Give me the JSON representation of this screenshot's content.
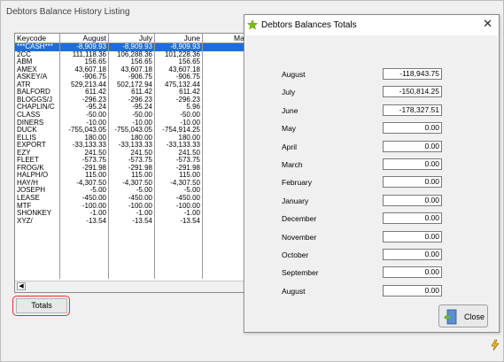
{
  "main_window": {
    "title": "Debtors Balance History Listing",
    "totals_button": "Totals"
  },
  "grid": {
    "columns": [
      "Keycode",
      "August",
      "July",
      "June",
      "Ma"
    ],
    "rows": [
      {
        "keycode": "***CASH***",
        "august": "-8,909.93",
        "july": "-8,909.93",
        "june": "-8,909.93"
      },
      {
        "keycode": "2CC",
        "august": "111,118.36",
        "july": "106,288.36",
        "june": "101,228.36"
      },
      {
        "keycode": "ABM",
        "august": "156.65",
        "july": "156.65",
        "june": "156.65"
      },
      {
        "keycode": "AMEX",
        "august": "43,607.18",
        "july": "43,607.18",
        "june": "43,607.18"
      },
      {
        "keycode": "ASKEY/A",
        "august": "-906.75",
        "july": "-906.75",
        "june": "-906.75"
      },
      {
        "keycode": "ATR",
        "august": "529,213.44",
        "july": "502,172.94",
        "june": "475,132.44"
      },
      {
        "keycode": "BALFORD",
        "august": "611.42",
        "july": "611.42",
        "june": "611.42"
      },
      {
        "keycode": "BLOGGS/J",
        "august": "-296.23",
        "july": "-296.23",
        "june": "-296.23"
      },
      {
        "keycode": "CHAPLIN/C",
        "august": "-95.24",
        "july": "-95.24",
        "june": "5.96"
      },
      {
        "keycode": "CLASS",
        "august": "-50.00",
        "july": "-50.00",
        "june": "-50.00"
      },
      {
        "keycode": "DINERS",
        "august": "-10.00",
        "july": "-10.00",
        "june": "-10.00"
      },
      {
        "keycode": "DUCK",
        "august": "-755,043.05",
        "july": "-755,043.05",
        "june": "-754,914.25"
      },
      {
        "keycode": "ELLIS",
        "august": "180.00",
        "july": "180.00",
        "june": "180.00"
      },
      {
        "keycode": "EXPORT",
        "august": "-33,133.33",
        "july": "-33,133.33",
        "june": "-33,133.33"
      },
      {
        "keycode": "EZY",
        "august": "241.50",
        "july": "241.50",
        "june": "241.50"
      },
      {
        "keycode": "FLEET",
        "august": "-573.75",
        "july": "-573.75",
        "june": "-573.75"
      },
      {
        "keycode": "FROG/K",
        "august": "-291.98",
        "july": "-291.98",
        "june": "-291.98"
      },
      {
        "keycode": "HALPH/O",
        "august": "115.00",
        "july": "115.00",
        "june": "115.00"
      },
      {
        "keycode": "HAY/H",
        "august": "-4,307.50",
        "july": "-4,307.50",
        "june": "-4,307.50"
      },
      {
        "keycode": "JOSEPH",
        "august": "-5.00",
        "july": "-5.00",
        "june": "-5.00"
      },
      {
        "keycode": "LEASE",
        "august": "-450.00",
        "july": "-450.00",
        "june": "-450.00"
      },
      {
        "keycode": "MTF",
        "august": "-100.00",
        "july": "-100.00",
        "june": "-100.00"
      },
      {
        "keycode": "SHONKEY",
        "august": "-1.00",
        "july": "-1.00",
        "june": "-1.00"
      },
      {
        "keycode": "XYZ/",
        "august": "-13.54",
        "july": "-13.54",
        "june": "-13.54"
      }
    ]
  },
  "dialog": {
    "title": "Debtors Balances Totals",
    "close_glyph": "✕",
    "close_button": "Close",
    "rows": [
      {
        "label": "August",
        "value": "-118,943.75"
      },
      {
        "label": "July",
        "value": "-150,814.25"
      },
      {
        "label": "June",
        "value": "-178,327.51"
      },
      {
        "label": "May",
        "value": "0.00"
      },
      {
        "label": "April",
        "value": "0.00"
      },
      {
        "label": "March",
        "value": "0.00"
      },
      {
        "label": "February",
        "value": "0.00"
      },
      {
        "label": "January",
        "value": "0.00"
      },
      {
        "label": "December",
        "value": "0.00"
      },
      {
        "label": "November",
        "value": "0.00"
      },
      {
        "label": "October",
        "value": "0.00"
      },
      {
        "label": "September",
        "value": "0.00"
      },
      {
        "label": "August",
        "value": "0.00"
      }
    ]
  },
  "colors": {
    "selection": "#1c6fd6",
    "highlight": "#e3312f"
  },
  "icons": [
    "star-icon",
    "close-icon",
    "exit-door-icon",
    "scroll-left-icon",
    "lightning-icon"
  ]
}
